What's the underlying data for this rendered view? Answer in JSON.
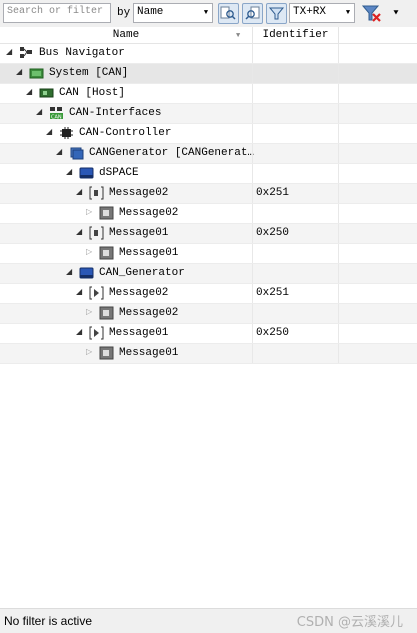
{
  "toolbar": {
    "search_placeholder": "Search or filter tex",
    "by_label": "by",
    "by_value": "Name",
    "direction_value": "TX+RX"
  },
  "columns": {
    "name": "Name",
    "identifier": "Identifier"
  },
  "tree": [
    {
      "label": "Bus Navigator",
      "id": "",
      "expander": "◢",
      "icon": "bus-navigator-icon",
      "depth": 0
    },
    {
      "label": "System [CAN]",
      "id": "",
      "expander": "◢",
      "icon": "system-icon",
      "depth": 1,
      "selected": true
    },
    {
      "label": "CAN [Host]",
      "id": "",
      "expander": "◢",
      "icon": "can-host-icon",
      "depth": 2
    },
    {
      "label": "CAN-Interfaces",
      "id": "",
      "expander": "◢",
      "icon": "can-interfaces-icon",
      "depth": 3
    },
    {
      "label": "CAN-Controller",
      "id": "",
      "expander": "◢",
      "icon": "chip-icon",
      "depth": 4
    },
    {
      "label": "CANGenerator [CANGenerat…",
      "id": "",
      "expander": "◢",
      "icon": "generator-icon",
      "depth": 5
    },
    {
      "label": "dSPACE",
      "id": "",
      "expander": "◢",
      "icon": "bus-icon",
      "depth": 6
    },
    {
      "label": "Message02",
      "id": "0x251",
      "expander": "◢",
      "icon": "rx-message-icon",
      "depth": 7
    },
    {
      "label": "Message02",
      "id": "",
      "expander": "▷",
      "icon": "message-icon",
      "depth": 8
    },
    {
      "label": "Message01",
      "id": "0x250",
      "expander": "◢",
      "icon": "rx-message-icon",
      "depth": 7
    },
    {
      "label": "Message01",
      "id": "",
      "expander": "▷",
      "icon": "message-icon",
      "depth": 8
    },
    {
      "label": "CAN_Generator",
      "id": "",
      "expander": "◢",
      "icon": "bus-icon",
      "depth": 6
    },
    {
      "label": "Message02",
      "id": "0x251",
      "expander": "◢",
      "icon": "tx-message-icon",
      "depth": 7
    },
    {
      "label": "Message02",
      "id": "",
      "expander": "▷",
      "icon": "message-icon",
      "depth": 8
    },
    {
      "label": "Message01",
      "id": "0x250",
      "expander": "◢",
      "icon": "tx-message-icon",
      "depth": 7
    },
    {
      "label": "Message01",
      "id": "",
      "expander": "▷",
      "icon": "message-icon",
      "depth": 8
    }
  ],
  "status": {
    "text": "No filter is active",
    "watermark": "CSDN @云溪溪儿"
  }
}
